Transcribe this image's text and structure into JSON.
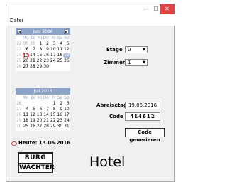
{
  "window": {
    "minimize_glyph": "—",
    "maximize_glyph": "☐",
    "close_glyph": "✕"
  },
  "menu": {
    "file_label": "Datei"
  },
  "calendar_june": {
    "month_label": "Juni 2016",
    "weekdays": [
      "Mo",
      "Di",
      "Mi",
      "Do",
      "Fr",
      "Sa",
      "So"
    ],
    "weeks": [
      {
        "wk": "22",
        "days": [
          "30",
          "31",
          "1",
          "2",
          "3",
          "4",
          "5"
        ]
      },
      {
        "wk": "23",
        "days": [
          "6",
          "7",
          "8",
          "9",
          "10",
          "11",
          "12"
        ]
      },
      {
        "wk": "24",
        "days": [
          "13",
          "14",
          "15",
          "16",
          "17",
          "18",
          "19"
        ]
      },
      {
        "wk": "25",
        "days": [
          "20",
          "21",
          "22",
          "23",
          "24",
          "25",
          "26"
        ]
      },
      {
        "wk": "26",
        "days": [
          "27",
          "28",
          "29",
          "30",
          "",
          "",
          ""
        ]
      }
    ]
  },
  "calendar_july": {
    "month_label": "Juli 2016",
    "weekdays": [
      "Mo",
      "Di",
      "Mi",
      "Do",
      "Fr",
      "Sa",
      "So"
    ],
    "weeks": [
      {
        "wk": "26",
        "days": [
          "",
          "",
          "",
          "",
          "1",
          "2",
          "3"
        ]
      },
      {
        "wk": "27",
        "days": [
          "4",
          "5",
          "6",
          "7",
          "8",
          "9",
          "10"
        ]
      },
      {
        "wk": "28",
        "days": [
          "11",
          "12",
          "13",
          "14",
          "15",
          "16",
          "17"
        ]
      },
      {
        "wk": "29",
        "days": [
          "18",
          "19",
          "20",
          "21",
          "22",
          "23",
          "24"
        ]
      },
      {
        "wk": "30",
        "days": [
          "25",
          "26",
          "27",
          "28",
          "29",
          "30",
          "31"
        ]
      }
    ]
  },
  "today": {
    "label": "Heute: 13.06.2016"
  },
  "form": {
    "etage_label": "Etage",
    "etage_value": "0",
    "zimmer_label": "Zimmer",
    "zimmer_value": "1",
    "abreisetag_label": "Abreisetag",
    "abreisetag_value": "19.06.2016",
    "code_label": "Code",
    "code_value": "414612",
    "generate_button": "Code generieren"
  },
  "logo": {
    "line1": "BURG",
    "line2": "WÄCHTER"
  },
  "brand_text": "Hotel",
  "colors": {
    "calendar_header": "#8ea3c8",
    "today_circle": "#d43c3c",
    "close_button": "#e04343"
  }
}
